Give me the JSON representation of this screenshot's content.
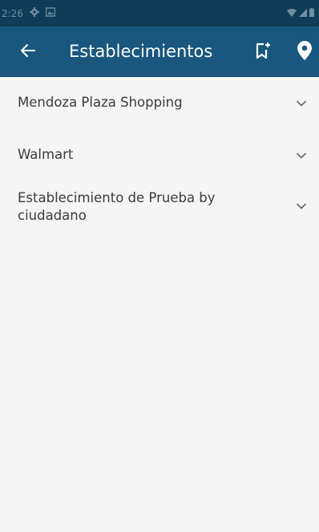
{
  "status_bar": {
    "time": "2:26",
    "icons": [
      "gear-icon",
      "image-icon",
      "wifi-icon",
      "signal-icon",
      "battery-icon"
    ]
  },
  "app_bar": {
    "title": "Establecimientos",
    "back_icon": "arrow-left-icon",
    "bookmark_icon": "bookmark-add-icon",
    "location_icon": "location-pin-icon",
    "background": "#19577e"
  },
  "items": [
    {
      "label": "Mendoza Plaza Shopping",
      "icon": "chevron-down-icon"
    },
    {
      "label": "Walmart",
      "icon": "chevron-down-icon"
    },
    {
      "label": "Establecimiento de Prueba by ciudadano",
      "icon": "chevron-down-icon"
    }
  ]
}
